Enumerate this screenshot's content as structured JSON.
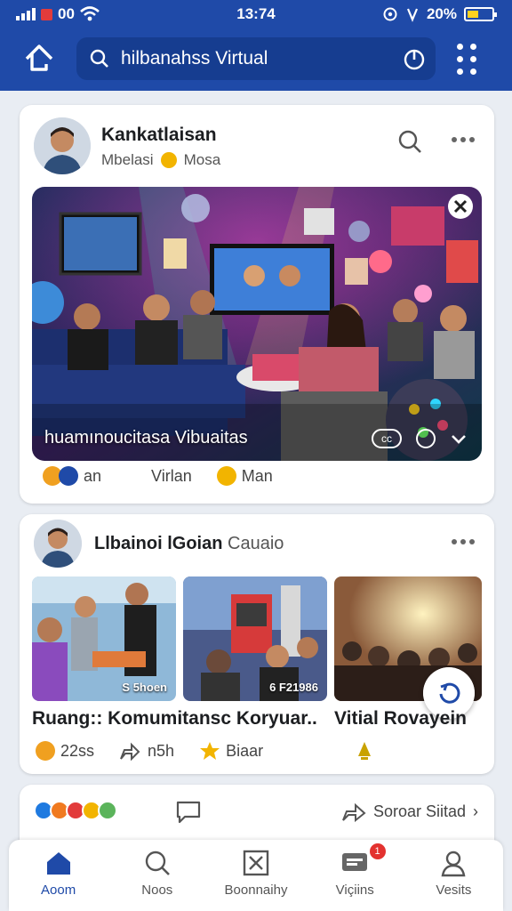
{
  "status_bar": {
    "carrier_text": "00",
    "time": "13:74",
    "battery_text": "20%",
    "icons": [
      "signal-icon",
      "recording-icon",
      "wifi-icon",
      "location-icon",
      "vibrate-icon",
      "battery-icon"
    ]
  },
  "app_bar": {
    "search_text": "hilbanahss Virtual",
    "icons": [
      "back-home-icon",
      "search-icon",
      "power-icon",
      "grid-menu-icon"
    ]
  },
  "colors": {
    "brand": "#1f4aa8",
    "search_bg": "#163d90",
    "card_bg": "#ffffff",
    "badge": "#e3322f"
  },
  "post1": {
    "author": "Kankatlaisan",
    "meta_left": "Mbelasi",
    "meta_right": "Mosa",
    "media_caption": "huamınoucitasa Vibuaitas",
    "reactions": [
      {
        "icon": "emoji-icon",
        "label": "an"
      },
      {
        "icon": "emoji-icon",
        "label": "Virlan"
      },
      {
        "icon": "emoji-icon",
        "label": "Man"
      }
    ]
  },
  "post2": {
    "author": "Llbainoi lGoian",
    "author_sub": "Cauaio",
    "thumbs": [
      {
        "tag": "S 5hoen"
      },
      {
        "tag": "6 F21986"
      },
      {
        "tag": ""
      }
    ],
    "title_left": "Ruang:: Komumitansc Koryuar..",
    "title_right": "Vitial Rovayein",
    "stats": [
      {
        "icon": "emoji-icon",
        "label": "22ss"
      },
      {
        "icon": "share-arrow-icon",
        "label": "n5h"
      },
      {
        "icon": "star-icon",
        "label": "Biaar"
      }
    ]
  },
  "post3": {
    "share_label": "Soroar Siitad"
  },
  "bottom_nav": {
    "items": [
      {
        "label": "Aoom",
        "icon": "home-icon"
      },
      {
        "label": "Noos",
        "icon": "search-icon"
      },
      {
        "label": "Boonnaihy",
        "icon": "box-x-icon"
      },
      {
        "label": "Viçiins",
        "icon": "chat-icon",
        "badge": "1"
      },
      {
        "label": "Vesits",
        "icon": "profile-icon"
      }
    ]
  }
}
